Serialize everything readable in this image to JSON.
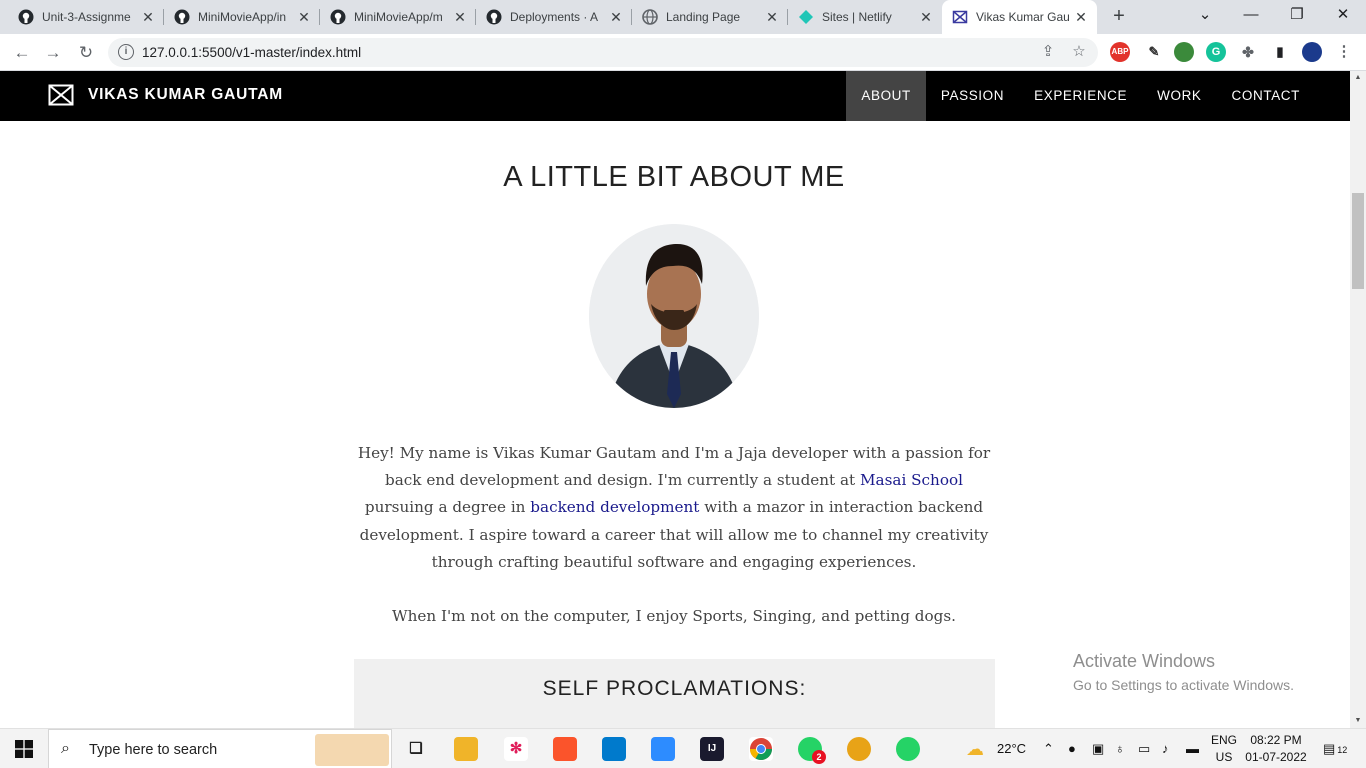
{
  "browser": {
    "tabs": [
      {
        "title": "Unit-3-Assignme",
        "icon": "github-icon"
      },
      {
        "title": "MiniMovieApp/in",
        "icon": "github-icon"
      },
      {
        "title": "MiniMovieApp/m",
        "icon": "github-icon"
      },
      {
        "title": "Deployments · A",
        "icon": "github-icon"
      },
      {
        "title": "Landing Page",
        "icon": "globe-icon"
      },
      {
        "title": "Sites | Netlify",
        "icon": "netlify-icon"
      },
      {
        "title": "Vikas Kumar Gau",
        "icon": "bowtie-logo-icon",
        "active": true
      }
    ],
    "url": "127.0.0.1:5500/v1-master/index.html",
    "ext_abp": "ABP"
  },
  "site": {
    "brand": "VIKAS KUMAR GAUTAM",
    "nav": [
      "ABOUT",
      "PASSION",
      "EXPERIENCE",
      "WORK",
      "CONTACT"
    ],
    "active_nav": "ABOUT",
    "about_title": "A LITTLE BIT ABOUT ME",
    "bio": {
      "p1": "Hey! My name is Vikas Kumar Gautam and I'm a Jaja developer with a passion for back end development and design. I'm currently a student at ",
      "link1": "Masai School",
      "p2": " pursuing a degree in ",
      "link2": "backend development",
      "p3": " with a mazor in interaction backend development. I aspire toward a career that will allow me to channel my creativity through crafting beautiful software and engaging experiences."
    },
    "hobbies": "When I'm not on the computer, I enjoy Sports, Singing, and petting dogs.",
    "proclamations_title": "SELF PROCLAMATIONS:"
  },
  "watermark": {
    "line1": "Activate Windows",
    "line2": "Go to Settings to activate Windows."
  },
  "taskbar": {
    "search_placeholder": "Type here to search",
    "whatsapp_badge": "2",
    "weather": "22°C",
    "lang_line1": "ENG",
    "lang_line2": "US",
    "time": "08:22 PM",
    "date": "01-07-2022",
    "notifications": "12"
  },
  "colors": {
    "nav_bg": "#000000",
    "nav_active": "#444444",
    "link": "#1a1a8c",
    "proclamation_bg": "#f0f0f0"
  }
}
